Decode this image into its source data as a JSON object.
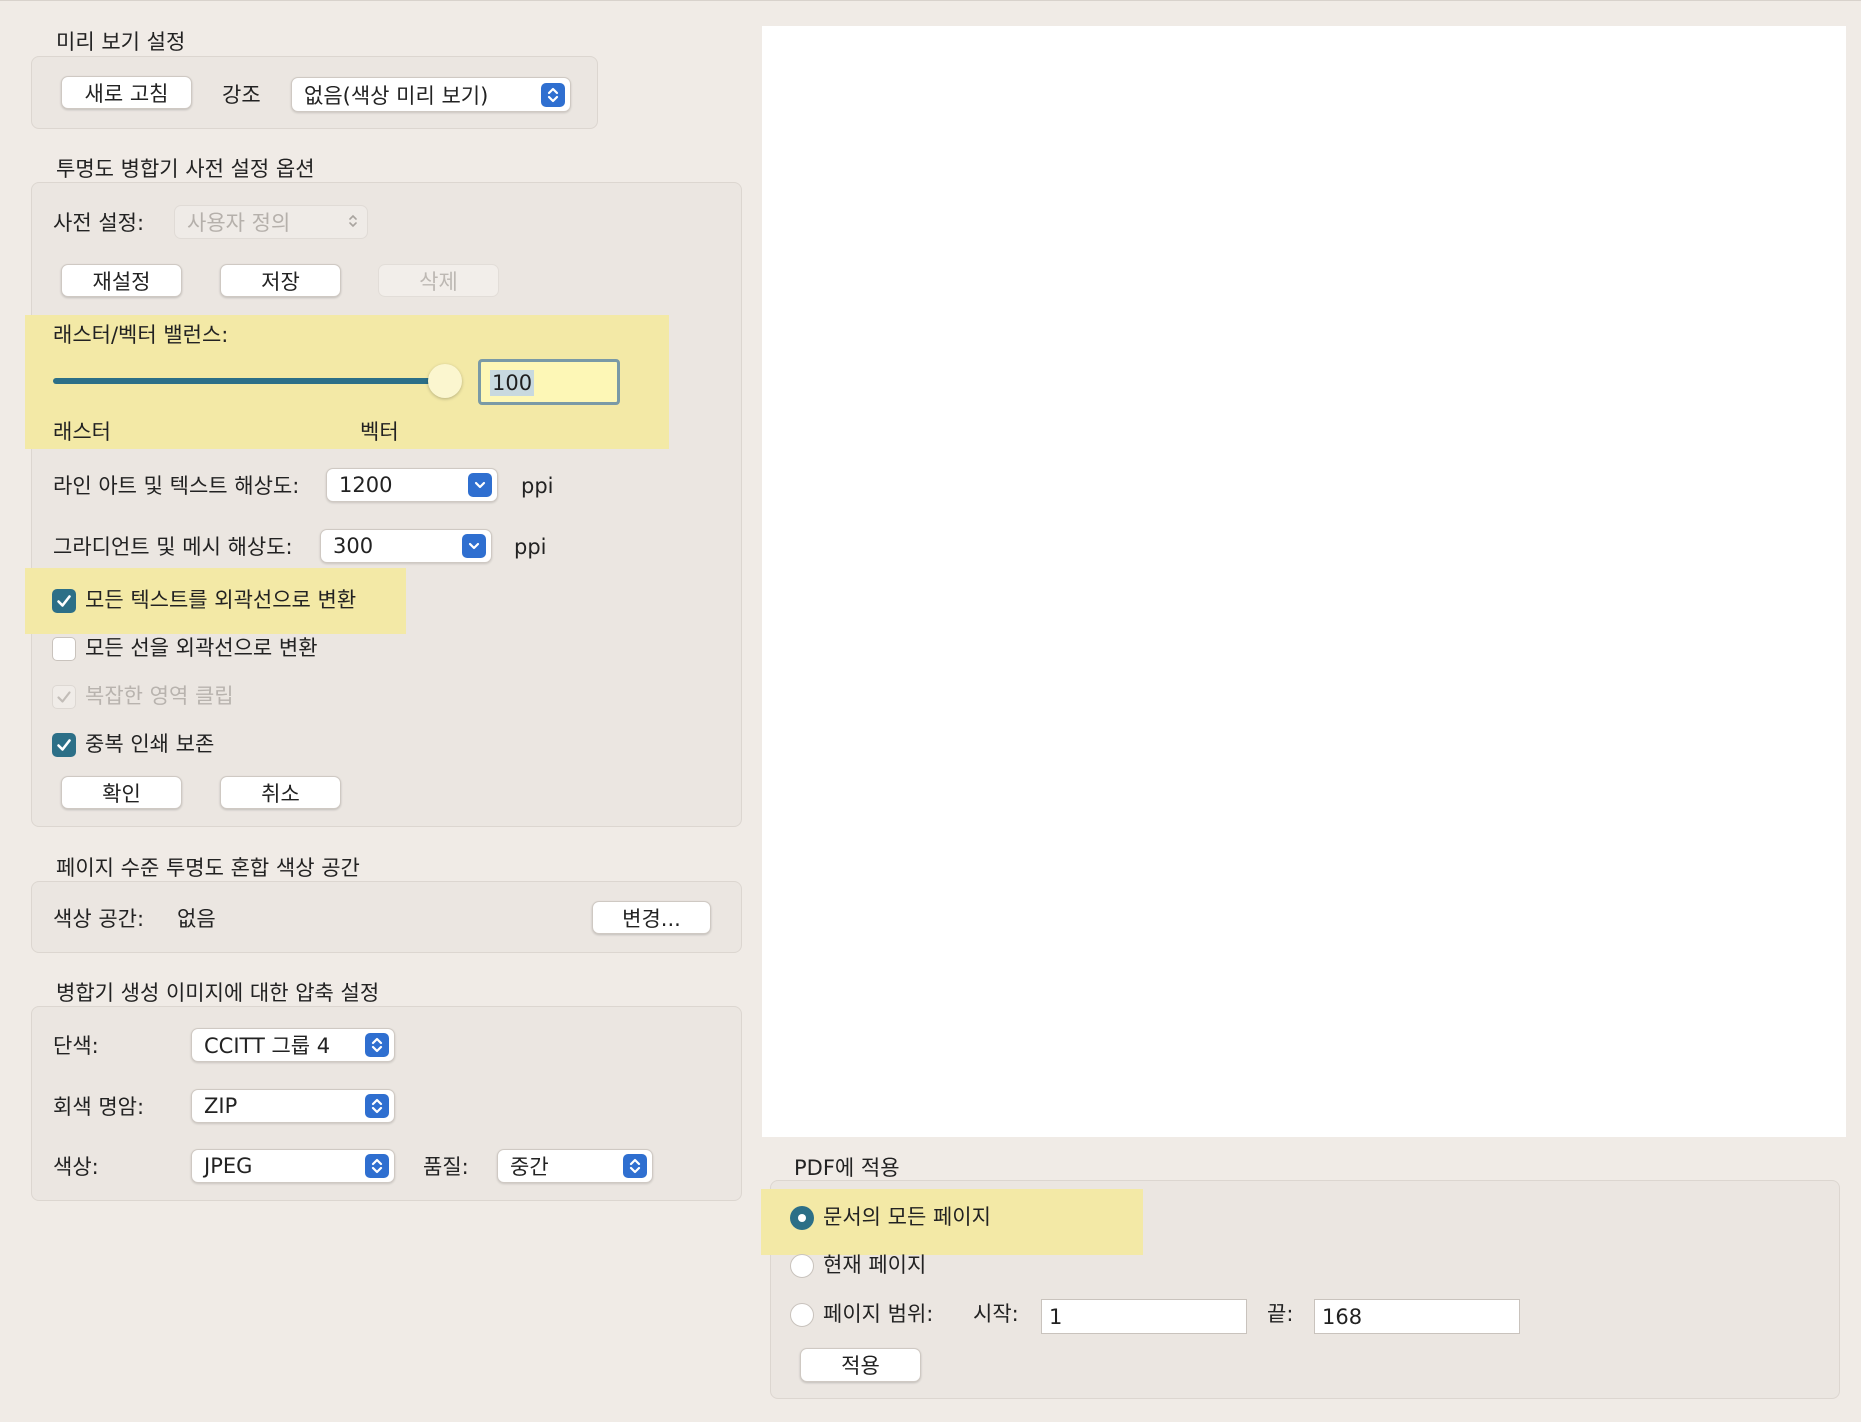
{
  "preview": {
    "title": "미리 보기 설정",
    "refresh_label": "새로 고침",
    "highlight_label": "강조",
    "highlight_value": "없음(색상 미리 보기)"
  },
  "flattener": {
    "title": "투명도 병합기 사전 설정 옵션",
    "preset_label": "사전 설정:",
    "preset_value": "사용자 정의",
    "reset_label": "재설정",
    "save_label": "저장",
    "delete_label": "삭제",
    "balance_label": "래스터/벡터 밸런스:",
    "balance_value": "100",
    "balance_fraction": 1.0,
    "raster_label": "래스터",
    "vector_label": "벡터",
    "lineart_label": "라인 아트 및 텍스트 해상도:",
    "lineart_value": "1200",
    "lineart_unit": "ppi",
    "gradient_label": "그라디언트 및 메시 해상도:",
    "gradient_value": "300",
    "gradient_unit": "ppi",
    "options": [
      {
        "label": "모든 텍스트를 외곽선으로 변환",
        "checked": true,
        "disabled": false
      },
      {
        "label": "모든 선을 외곽선으로 변환",
        "checked": false,
        "disabled": false
      },
      {
        "label": "복잡한 영역 클립",
        "checked": true,
        "disabled": true
      },
      {
        "label": "중복 인쇄 보존",
        "checked": true,
        "disabled": false
      }
    ],
    "ok_label": "확인",
    "cancel_label": "취소"
  },
  "colorspace": {
    "title": "페이지 수준 투명도 혼합 색상 공간",
    "label": "색상 공간:",
    "value": "없음",
    "change_label": "변경..."
  },
  "compression": {
    "title": "병합기 생성 이미지에 대한 압축 설정",
    "mono_label": "단색:",
    "mono_value": "CCITT 그룹 4",
    "gray_label": "회색 명암:",
    "gray_value": "ZIP",
    "color_label": "색상:",
    "color_value": "JPEG",
    "quality_label": "품질:",
    "quality_value": "중간"
  },
  "apply": {
    "title": "PDF에 적용",
    "all_pages_label": "문서의 모든 페이지",
    "current_page_label": "현재 페이지",
    "range_label": "페이지 범위:",
    "start_label": "시작:",
    "start_value": "1",
    "end_label": "끝:",
    "end_value": "168",
    "apply_label": "적용",
    "selected": "all"
  },
  "colors": {
    "highlight": "#f3e9a6",
    "accent": "#2c6f87",
    "select_indicator": "#2f6fd0"
  }
}
